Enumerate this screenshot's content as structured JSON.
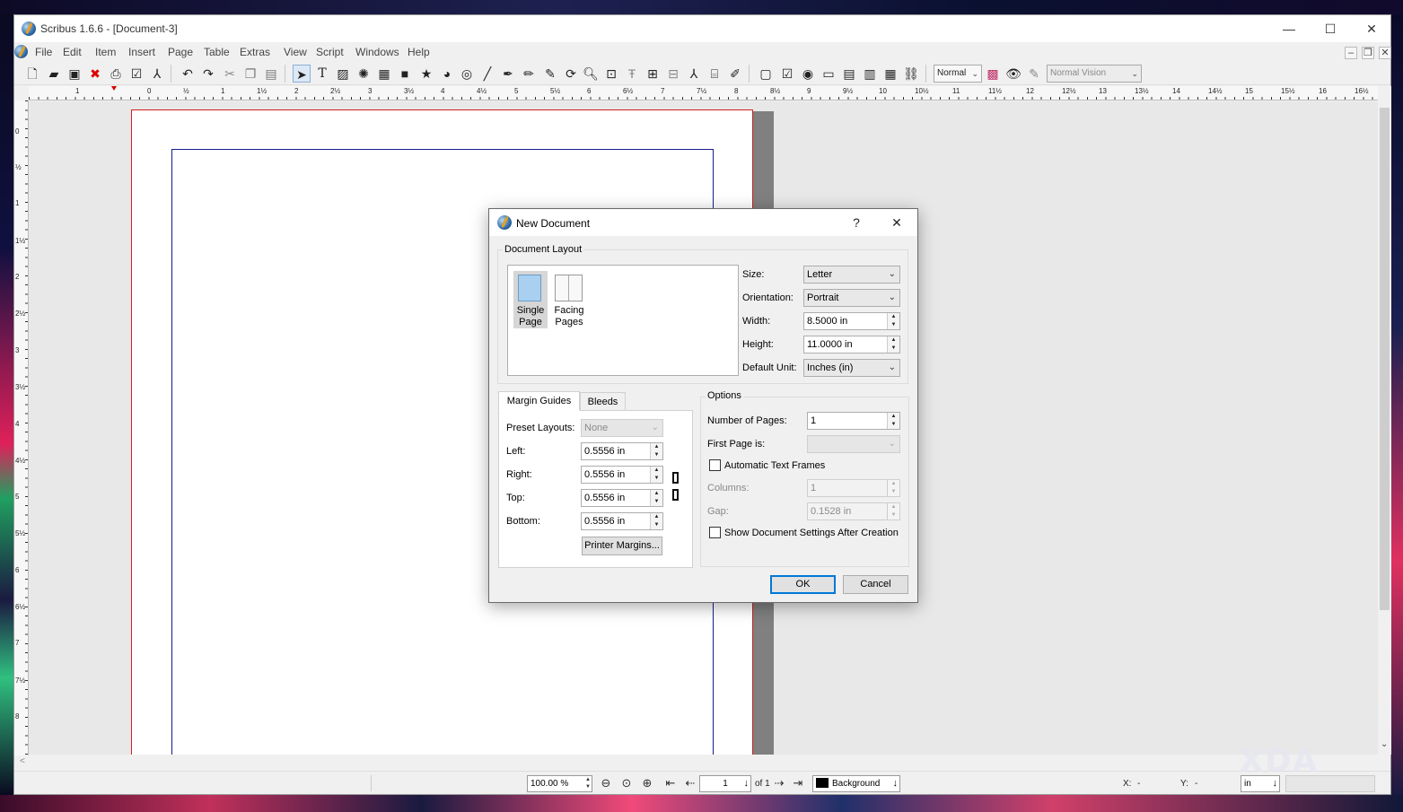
{
  "app": {
    "title": "Scribus 1.6.6 - [Document-3]",
    "window_controls": {
      "minimize": "—",
      "maximize": "☐",
      "close": "✕"
    }
  },
  "menu": [
    "File",
    "Edit",
    "Item",
    "Insert",
    "Page",
    "Table",
    "Extras",
    "View",
    "Script",
    "Windows",
    "Help"
  ],
  "mdi_controls": {
    "minimize": "‒",
    "restore": "❐",
    "close": "✕"
  },
  "toolbar": {
    "mode_select": "Normal",
    "vision_select": "Normal Vision"
  },
  "ruler": {
    "horizontal_labels": [
      "1",
      "0",
      "½",
      "1",
      "1½",
      "2",
      "2½",
      "3",
      "3½",
      "4",
      "4½",
      "5",
      "5½",
      "6",
      "6½",
      "7",
      "7½",
      "8",
      "8½",
      "9",
      "9½",
      "10",
      "10½",
      "11",
      "11½",
      "12",
      "12½",
      "13",
      "13½",
      "14",
      "14½",
      "15",
      "15½",
      "16",
      "16½"
    ],
    "vertical_labels": [
      "0",
      "½",
      "1",
      "1½",
      "2",
      "2½",
      "3",
      "3½",
      "4",
      "4½",
      "5",
      "5½",
      "6",
      "6½",
      "7",
      "7½",
      "8"
    ]
  },
  "statusbar": {
    "zoom": "100.00 %",
    "page_number": "1",
    "page_of": "of 1",
    "layer": "Background",
    "x_label": "X:",
    "x_value": "-",
    "y_label": "Y:",
    "y_value": "-",
    "unit": "in"
  },
  "watermark": "XDA",
  "dialog": {
    "title": "New Document",
    "help": "?",
    "close": "✕",
    "document_layout": {
      "label": "Document Layout",
      "options": [
        {
          "label_line1": "Single",
          "label_line2": "Page",
          "selected": true
        },
        {
          "label_line1": "Facing",
          "label_line2": "Pages",
          "selected": false
        }
      ],
      "size_label": "Size:",
      "size_value": "Letter",
      "orientation_label": "Orientation:",
      "orientation_value": "Portrait",
      "width_label": "Width:",
      "width_value": "8.5000 in",
      "height_label": "Height:",
      "height_value": "11.0000 in",
      "unit_label": "Default Unit:",
      "unit_value": "Inches (in)"
    },
    "tabs": [
      "Margin Guides",
      "Bleeds"
    ],
    "margins": {
      "preset_label": "Preset Layouts:",
      "preset_value": "None",
      "left_label": "Left:",
      "left_value": "0.5556 in",
      "right_label": "Right:",
      "right_value": "0.5556 in",
      "top_label": "Top:",
      "top_value": "0.5556 in",
      "bottom_label": "Bottom:",
      "bottom_value": "0.5556 in",
      "printer_margins_button": "Printer Margins..."
    },
    "options": {
      "label": "Options",
      "pages_label": "Number of Pages:",
      "pages_value": "1",
      "first_page_label": "First Page is:",
      "first_page_value": "",
      "auto_text_frames_label": "Automatic Text Frames",
      "auto_text_frames_checked": false,
      "columns_label": "Columns:",
      "columns_value": "1",
      "gap_label": "Gap:",
      "gap_value": "0.1528 in",
      "show_settings_label": "Show Document Settings After Creation",
      "show_settings_checked": false
    },
    "ok_button": "OK",
    "cancel_button": "Cancel"
  }
}
